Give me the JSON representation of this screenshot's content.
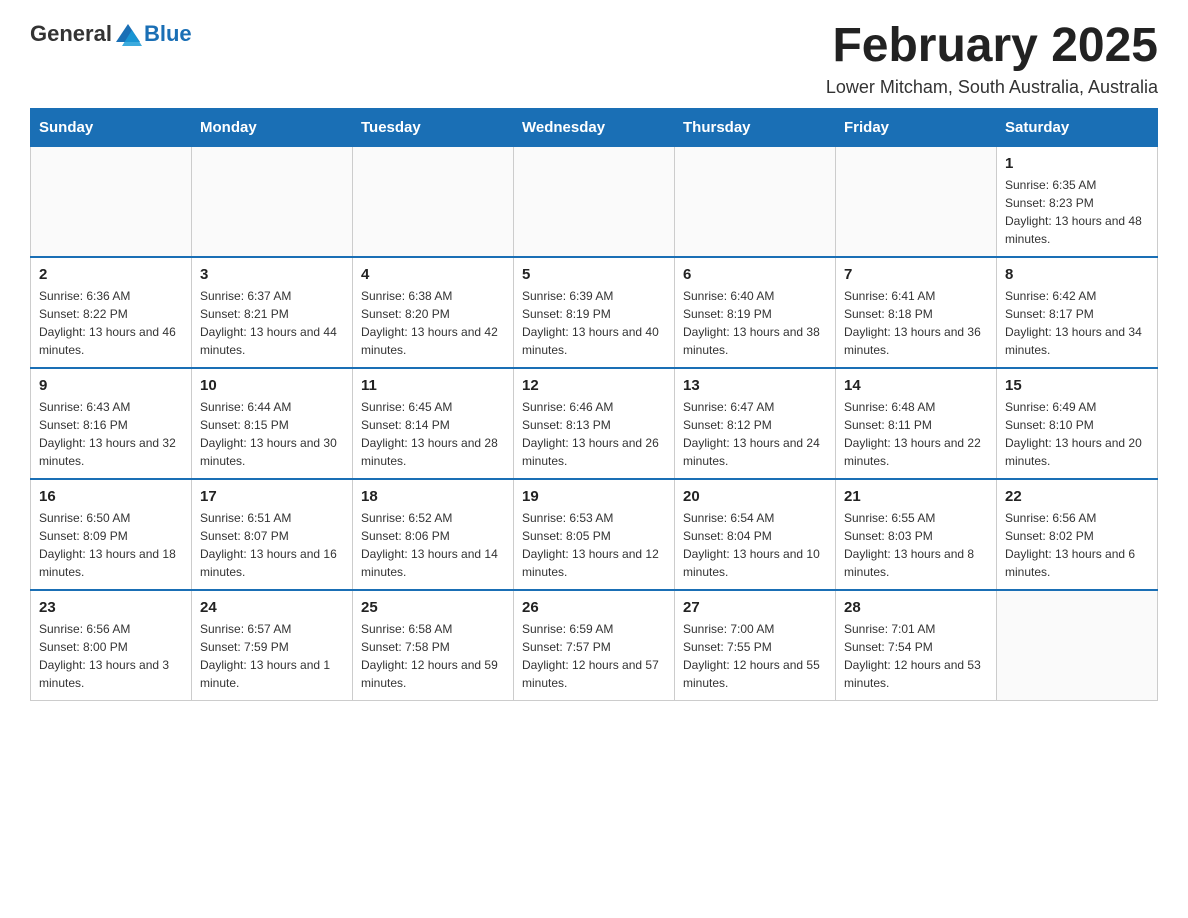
{
  "logo": {
    "text_general": "General",
    "text_blue": "Blue"
  },
  "title": "February 2025",
  "subtitle": "Lower Mitcham, South Australia, Australia",
  "days_of_week": [
    "Sunday",
    "Monday",
    "Tuesday",
    "Wednesday",
    "Thursday",
    "Friday",
    "Saturday"
  ],
  "weeks": [
    [
      {
        "day": "",
        "info": ""
      },
      {
        "day": "",
        "info": ""
      },
      {
        "day": "",
        "info": ""
      },
      {
        "day": "",
        "info": ""
      },
      {
        "day": "",
        "info": ""
      },
      {
        "day": "",
        "info": ""
      },
      {
        "day": "1",
        "info": "Sunrise: 6:35 AM\nSunset: 8:23 PM\nDaylight: 13 hours and 48 minutes."
      }
    ],
    [
      {
        "day": "2",
        "info": "Sunrise: 6:36 AM\nSunset: 8:22 PM\nDaylight: 13 hours and 46 minutes."
      },
      {
        "day": "3",
        "info": "Sunrise: 6:37 AM\nSunset: 8:21 PM\nDaylight: 13 hours and 44 minutes."
      },
      {
        "day": "4",
        "info": "Sunrise: 6:38 AM\nSunset: 8:20 PM\nDaylight: 13 hours and 42 minutes."
      },
      {
        "day": "5",
        "info": "Sunrise: 6:39 AM\nSunset: 8:19 PM\nDaylight: 13 hours and 40 minutes."
      },
      {
        "day": "6",
        "info": "Sunrise: 6:40 AM\nSunset: 8:19 PM\nDaylight: 13 hours and 38 minutes."
      },
      {
        "day": "7",
        "info": "Sunrise: 6:41 AM\nSunset: 8:18 PM\nDaylight: 13 hours and 36 minutes."
      },
      {
        "day": "8",
        "info": "Sunrise: 6:42 AM\nSunset: 8:17 PM\nDaylight: 13 hours and 34 minutes."
      }
    ],
    [
      {
        "day": "9",
        "info": "Sunrise: 6:43 AM\nSunset: 8:16 PM\nDaylight: 13 hours and 32 minutes."
      },
      {
        "day": "10",
        "info": "Sunrise: 6:44 AM\nSunset: 8:15 PM\nDaylight: 13 hours and 30 minutes."
      },
      {
        "day": "11",
        "info": "Sunrise: 6:45 AM\nSunset: 8:14 PM\nDaylight: 13 hours and 28 minutes."
      },
      {
        "day": "12",
        "info": "Sunrise: 6:46 AM\nSunset: 8:13 PM\nDaylight: 13 hours and 26 minutes."
      },
      {
        "day": "13",
        "info": "Sunrise: 6:47 AM\nSunset: 8:12 PM\nDaylight: 13 hours and 24 minutes."
      },
      {
        "day": "14",
        "info": "Sunrise: 6:48 AM\nSunset: 8:11 PM\nDaylight: 13 hours and 22 minutes."
      },
      {
        "day": "15",
        "info": "Sunrise: 6:49 AM\nSunset: 8:10 PM\nDaylight: 13 hours and 20 minutes."
      }
    ],
    [
      {
        "day": "16",
        "info": "Sunrise: 6:50 AM\nSunset: 8:09 PM\nDaylight: 13 hours and 18 minutes."
      },
      {
        "day": "17",
        "info": "Sunrise: 6:51 AM\nSunset: 8:07 PM\nDaylight: 13 hours and 16 minutes."
      },
      {
        "day": "18",
        "info": "Sunrise: 6:52 AM\nSunset: 8:06 PM\nDaylight: 13 hours and 14 minutes."
      },
      {
        "day": "19",
        "info": "Sunrise: 6:53 AM\nSunset: 8:05 PM\nDaylight: 13 hours and 12 minutes."
      },
      {
        "day": "20",
        "info": "Sunrise: 6:54 AM\nSunset: 8:04 PM\nDaylight: 13 hours and 10 minutes."
      },
      {
        "day": "21",
        "info": "Sunrise: 6:55 AM\nSunset: 8:03 PM\nDaylight: 13 hours and 8 minutes."
      },
      {
        "day": "22",
        "info": "Sunrise: 6:56 AM\nSunset: 8:02 PM\nDaylight: 13 hours and 6 minutes."
      }
    ],
    [
      {
        "day": "23",
        "info": "Sunrise: 6:56 AM\nSunset: 8:00 PM\nDaylight: 13 hours and 3 minutes."
      },
      {
        "day": "24",
        "info": "Sunrise: 6:57 AM\nSunset: 7:59 PM\nDaylight: 13 hours and 1 minute."
      },
      {
        "day": "25",
        "info": "Sunrise: 6:58 AM\nSunset: 7:58 PM\nDaylight: 12 hours and 59 minutes."
      },
      {
        "day": "26",
        "info": "Sunrise: 6:59 AM\nSunset: 7:57 PM\nDaylight: 12 hours and 57 minutes."
      },
      {
        "day": "27",
        "info": "Sunrise: 7:00 AM\nSunset: 7:55 PM\nDaylight: 12 hours and 55 minutes."
      },
      {
        "day": "28",
        "info": "Sunrise: 7:01 AM\nSunset: 7:54 PM\nDaylight: 12 hours and 53 minutes."
      },
      {
        "day": "",
        "info": ""
      }
    ]
  ]
}
